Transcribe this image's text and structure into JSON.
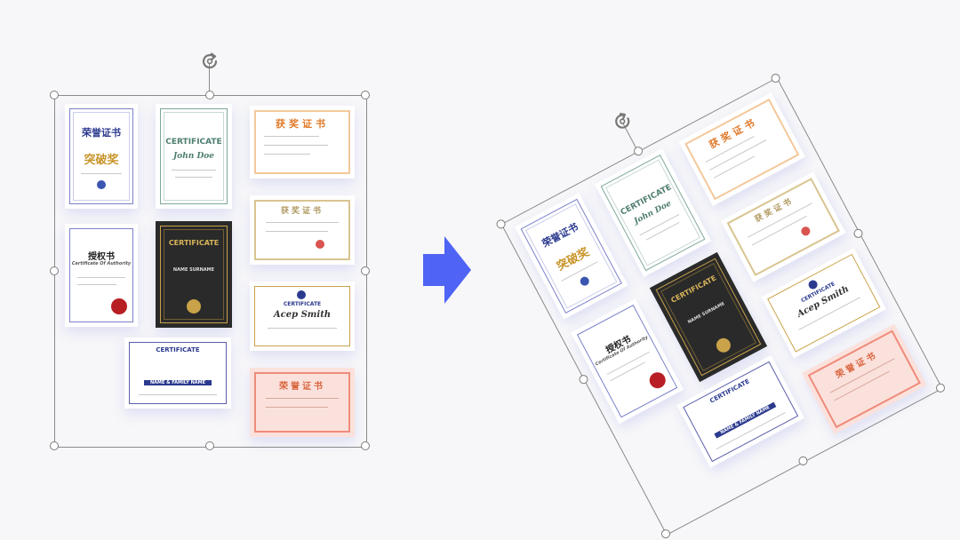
{
  "colors": {
    "arrow": "#4f63f5",
    "handle_border": "#7d7d7d",
    "selection_border": "#8a8a8a"
  },
  "icons": {
    "rotate": "rotate-icon",
    "arrow": "arrow-right-icon"
  },
  "cards": {
    "c1": {
      "title": "荣誉证书",
      "sub": "突破奖"
    },
    "c2": {
      "title": "CERTIFICATE",
      "sub": "John Doe"
    },
    "c3": {
      "title": "获奖证书"
    },
    "c4": {
      "title": "授权书",
      "sub": "Certificate Of Authority"
    },
    "c5": {
      "title": "CERTIFICATE",
      "sub": "NAME SURNAME"
    },
    "c6": {
      "title": "获奖证书"
    },
    "c7": {
      "title": "CERTIFICATE",
      "sub": "Acep Smith"
    },
    "c8": {
      "title": "CERTIFICATE",
      "sub": "NAME & FAMILY NAME"
    },
    "c9": {
      "title": "荣誉证书"
    }
  }
}
